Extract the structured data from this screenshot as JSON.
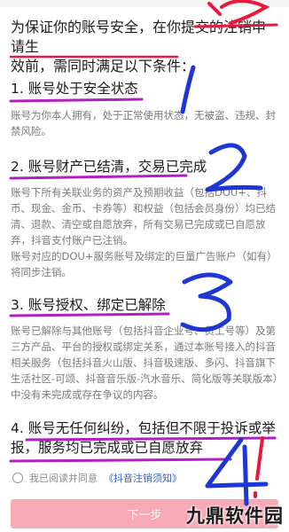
{
  "intro": {
    "line1": "为保证你的账号安全，在你提交的注销申请生",
    "line2": "效前，需同时满足以下条件："
  },
  "conditions": [
    {
      "title": "1. 账号处于安全状态",
      "body": "账号为你本人拥有，处于正常使用状态，无被盗、违规、封禁风险。"
    },
    {
      "title": "2. 账号财产已结清，交易已完成",
      "body": "账号下所有关联业务的资产及预期收益（包括DOU+、抖币、现金、金币、卡券等）和权益（包括会员身份）均已结清、退款、清空或自愿放弃，所有交易已完成或已自愿放弃，抖音支付账户已注销。",
      "body2": "账号对应的DOU+服务账号及绑定的巨量广告账户（如有）将同步注销。"
    },
    {
      "title": "3. 账号授权、绑定已解除",
      "body": "账号已解除与其他账号（包括抖音企业号、员工号等）及第三方产品、平台的授权或绑定关系，通过本账号接入的抖音相关服务（包括抖音火山版、抖音极速版、多闪、抖音旗下生活社区-可颂、抖音音乐版-汽水音乐、简化版等关联版本）中没有未完成或存在争议的内容。"
    },
    {
      "title": "4. 账号无任何纠纷，包括但不限于投诉或举报，服务均已完成或已自愿放弃"
    }
  ],
  "consent": {
    "prefix": "我已阅读并同意",
    "link": "《抖音注销须知》"
  },
  "next_button": "下一步",
  "watermark": "九鼎软件园",
  "colors": {
    "annotation_red": "#e8193c",
    "annotation_blue": "#1f36d6",
    "annotation_purple": "#b21fc0",
    "button_pink": "#f7a9b5",
    "link_blue": "#2f64c8"
  }
}
